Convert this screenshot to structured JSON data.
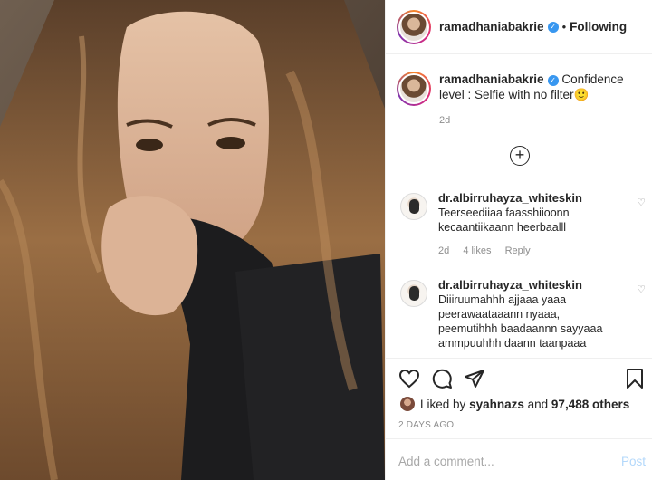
{
  "post": {
    "username": "ramadhaniabakrie",
    "separator": "•",
    "follow_status": "Following"
  },
  "caption": {
    "username": "ramadhaniabakrie",
    "text": "Confidence level : Selfie with no filter",
    "emoji": "🙂",
    "time": "2d"
  },
  "comments": [
    {
      "username": "dr.albirruhayza_whiteskin",
      "text": "Teerseediiaa faasshiioonn kecaantiikaann heerbaalll",
      "time": "2d",
      "likes": "4 likes",
      "reply": "Reply"
    },
    {
      "username": "dr.albirruhayza_whiteskin",
      "text": "Diiiruumahhh ajjaaa yaaa peerawaataaann nyaaa, peemutihhh baadaannn sayyaaa ammpuuhhh daann taanpaaa",
      "time": "",
      "likes": "",
      "reply": ""
    }
  ],
  "likes": {
    "prefix": "Liked by",
    "user": "syahnazs",
    "middle": "and",
    "count": "97,488 others"
  },
  "date": "2 DAYS AGO",
  "comment_input": {
    "placeholder": "Add a comment...",
    "post_label": "Post"
  },
  "colors": {
    "verified": "#3897f0",
    "muted": "#8e8e8e",
    "post_disabled": "#b3d8fb"
  },
  "icons": {
    "load_more": "plus-circle-icon",
    "like": "heart-icon",
    "comment": "comment-bubble-icon",
    "share": "paper-plane-icon",
    "save": "bookmark-icon"
  }
}
